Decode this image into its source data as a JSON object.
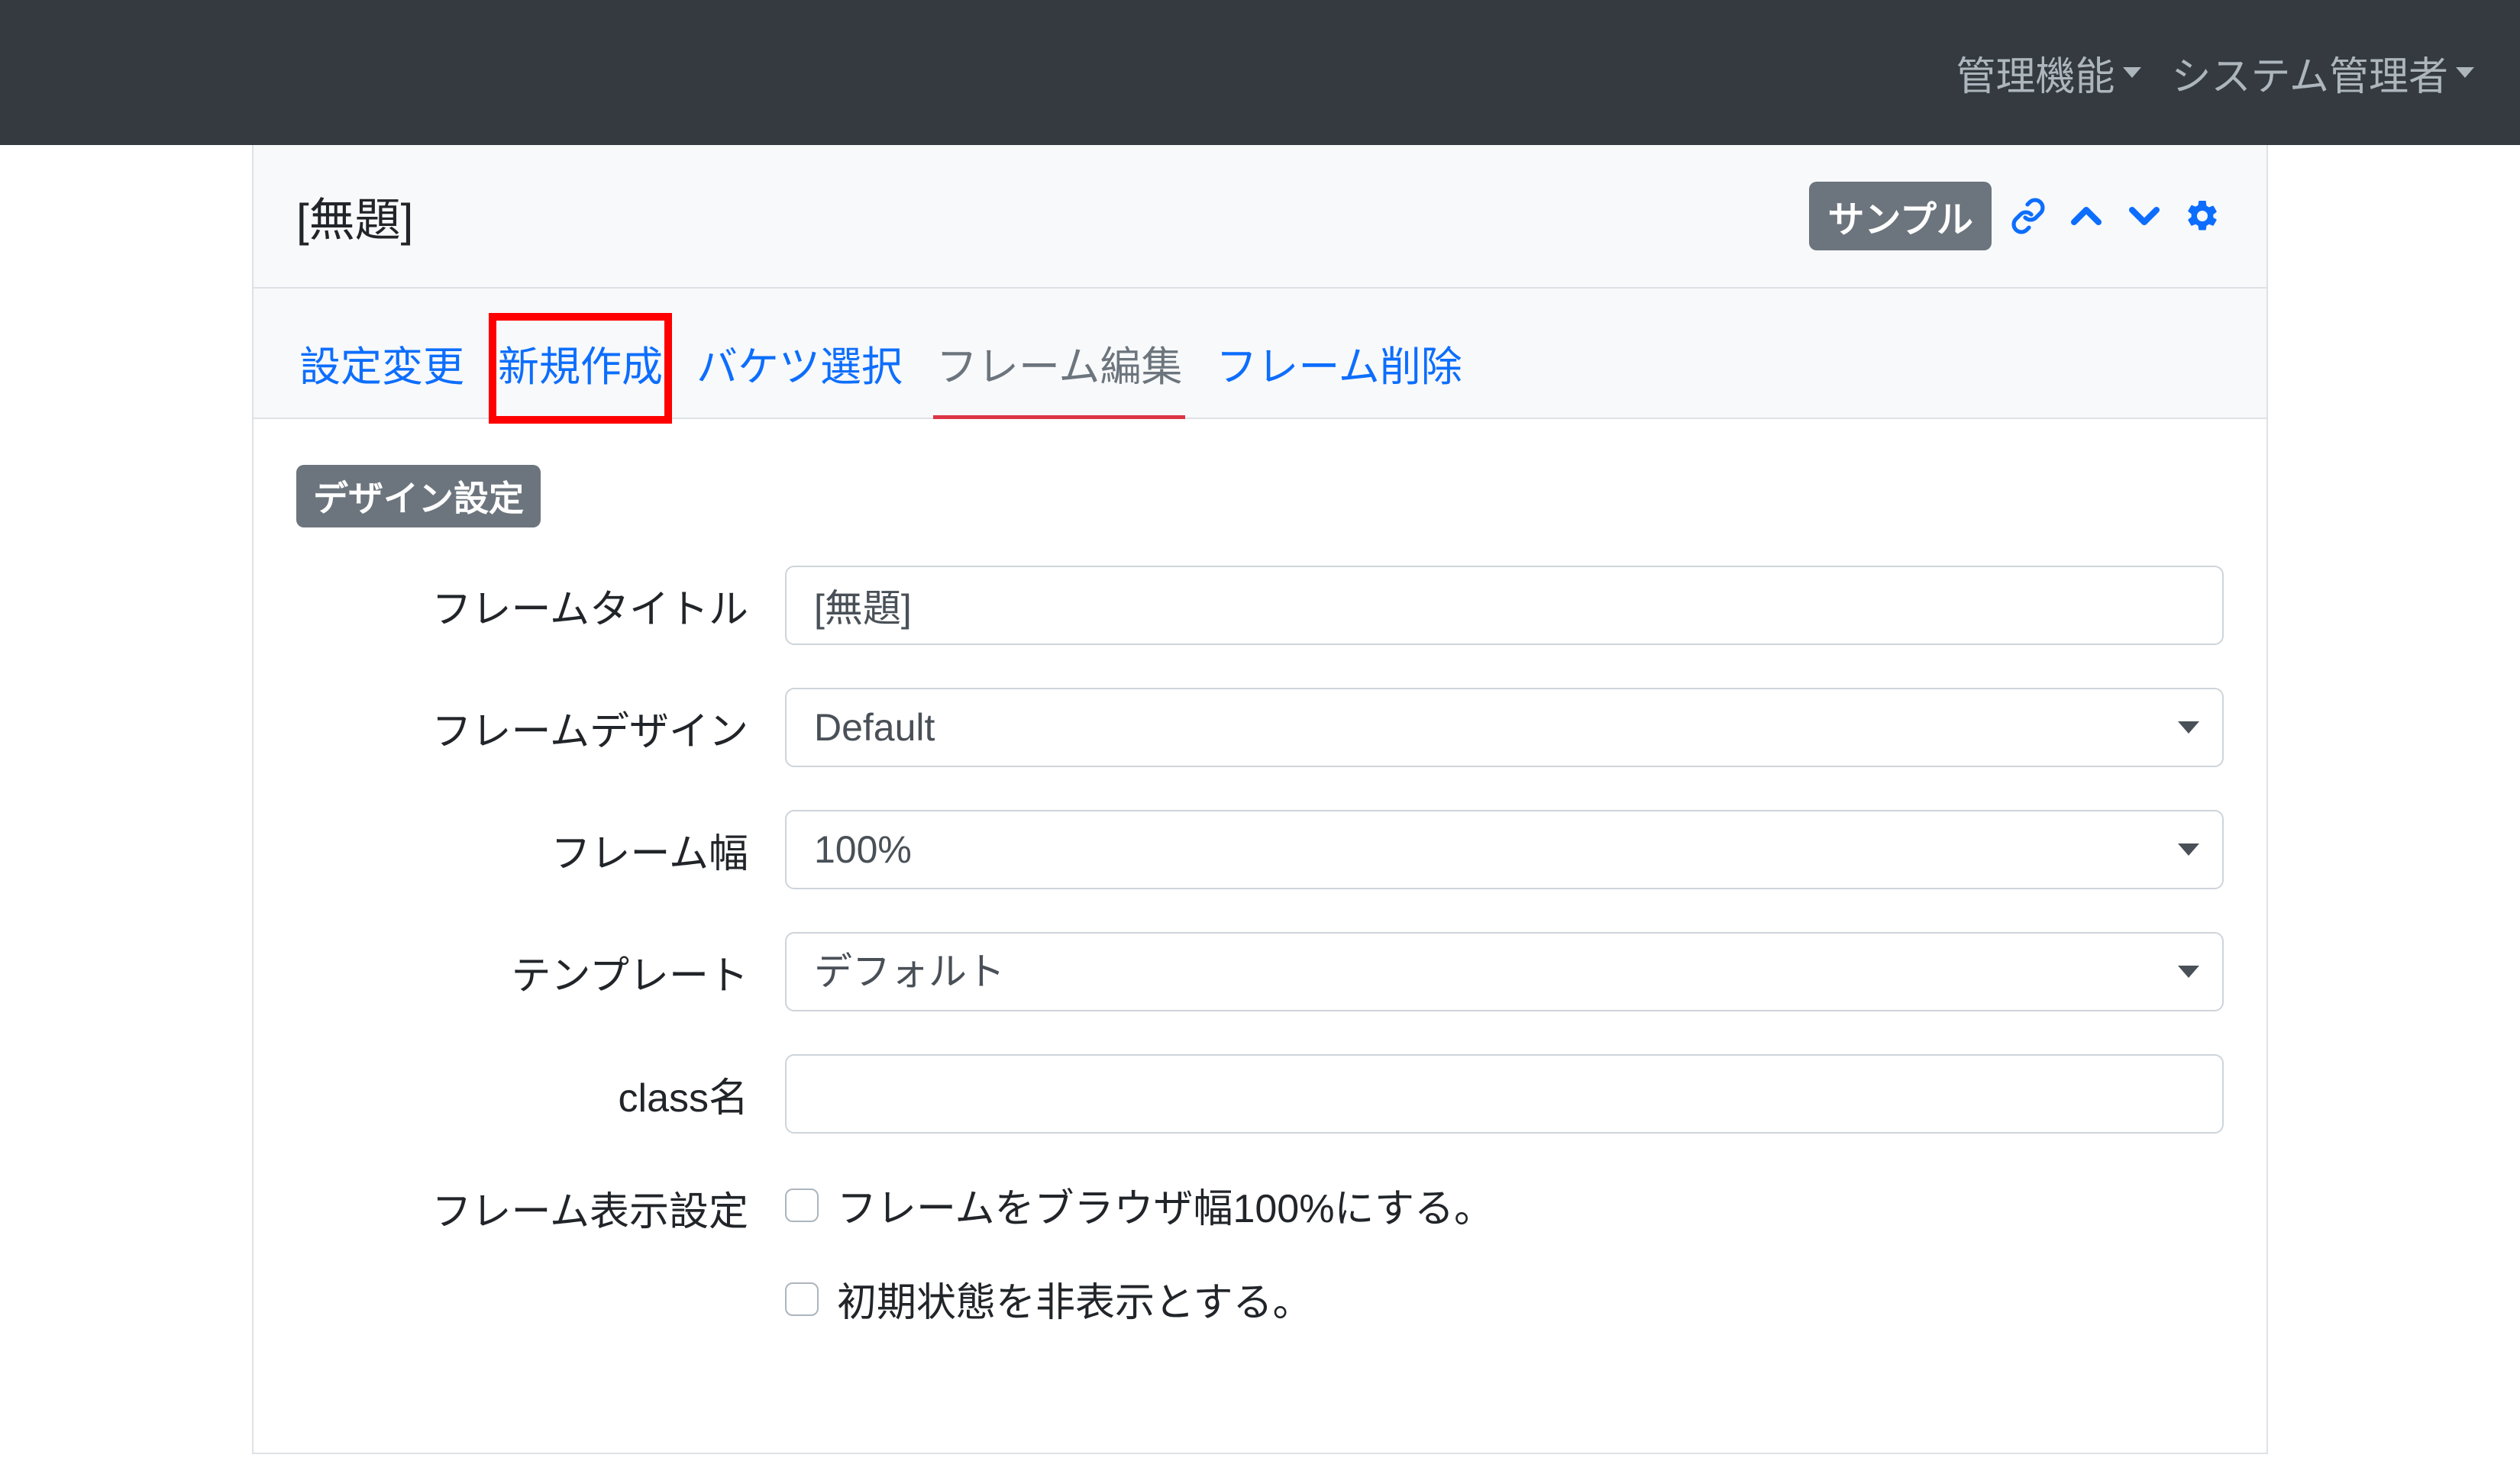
{
  "navbar": {
    "admin_menu": "管理機能",
    "user_menu": "システム管理者"
  },
  "panel": {
    "title": "[無題]",
    "sample_badge": "サンプル"
  },
  "tabs": {
    "settings": "設定変更",
    "new": "新規作成",
    "bucket": "バケツ選択",
    "frame_edit": "フレーム編集",
    "frame_delete": "フレーム削除"
  },
  "section": {
    "design_badge": "デザイン設定"
  },
  "form": {
    "frame_title_label": "フレームタイトル",
    "frame_title_value": "[無題]",
    "frame_design_label": "フレームデザイン",
    "frame_design_value": "Default",
    "frame_width_label": "フレーム幅",
    "frame_width_value": "100%",
    "template_label": "テンプレート",
    "template_value": "デフォルト",
    "class_label": "class名",
    "class_value": "",
    "display_label": "フレーム表示設定",
    "cb_fullwidth": "フレームをブラウザ幅100%にする。",
    "cb_hidden": "初期状態を非表示とする。"
  }
}
